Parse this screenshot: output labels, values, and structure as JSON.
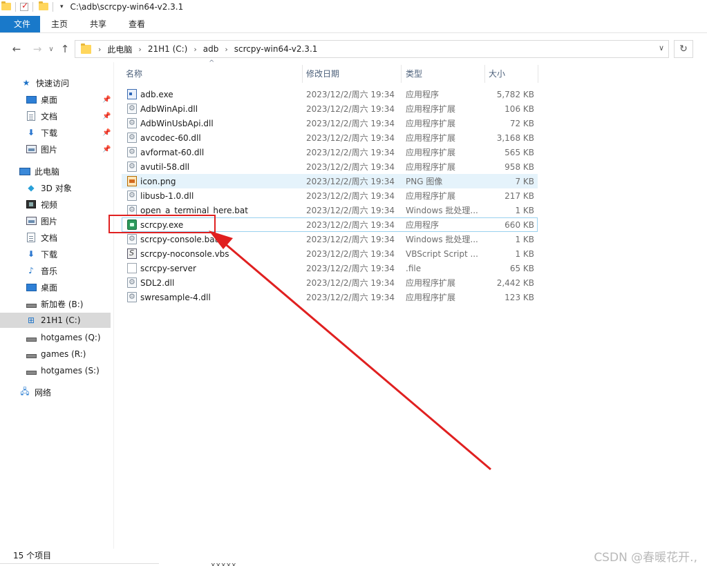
{
  "titlebar": {
    "title": "C:\\adb\\scrcpy-win64-v2.3.1",
    "dropdown": "▾"
  },
  "ribbon": {
    "tabs": [
      "文件",
      "主页",
      "共享",
      "查看"
    ]
  },
  "nav": {
    "back": "←",
    "forward": "→",
    "recent": "∨",
    "up": "↑",
    "breadcrumb": [
      "此电脑",
      "21H1 (C:)",
      "adb",
      "scrcpy-win64-v2.3.1"
    ],
    "crumb_sep": "›",
    "addr_dropdown": "∨",
    "refresh": "↻"
  },
  "sidebar": {
    "quick_access": "快速访问",
    "quick_items": [
      "桌面",
      "文档",
      "下载",
      "图片"
    ],
    "this_pc": "此电脑",
    "pc_items": [
      "3D 对象",
      "视频",
      "图片",
      "文档",
      "下载",
      "音乐",
      "桌面"
    ],
    "drives": [
      "新加卷 (B:)",
      "21H1 (C:)",
      "hotgames (Q:)",
      "games (R:)",
      "hotgames (S:)"
    ],
    "network": "网络",
    "pin": "📌"
  },
  "columns": {
    "name": "名称",
    "modified": "修改日期",
    "type": "类型",
    "size": "大小",
    "sort_indicator": "^"
  },
  "files": [
    {
      "name": "adb.exe",
      "date": "2023/12/2/周六 19:34",
      "type": "应用程序",
      "size": "5,782 KB"
    },
    {
      "name": "AdbWinApi.dll",
      "date": "2023/12/2/周六 19:34",
      "type": "应用程序扩展",
      "size": "106 KB"
    },
    {
      "name": "AdbWinUsbApi.dll",
      "date": "2023/12/2/周六 19:34",
      "type": "应用程序扩展",
      "size": "72 KB"
    },
    {
      "name": "avcodec-60.dll",
      "date": "2023/12/2/周六 19:34",
      "type": "应用程序扩展",
      "size": "3,168 KB"
    },
    {
      "name": "avformat-60.dll",
      "date": "2023/12/2/周六 19:34",
      "type": "应用程序扩展",
      "size": "565 KB"
    },
    {
      "name": "avutil-58.dll",
      "date": "2023/12/2/周六 19:34",
      "type": "应用程序扩展",
      "size": "958 KB"
    },
    {
      "name": "icon.png",
      "date": "2023/12/2/周六 19:34",
      "type": "PNG 图像",
      "size": "7 KB"
    },
    {
      "name": "libusb-1.0.dll",
      "date": "2023/12/2/周六 19:34",
      "type": "应用程序扩展",
      "size": "217 KB"
    },
    {
      "name": "open_a_terminal_here.bat",
      "date": "2023/12/2/周六 19:34",
      "type": "Windows 批处理...",
      "size": "1 KB"
    },
    {
      "name": "scrcpy.exe",
      "date": "2023/12/2/周六 19:34",
      "type": "应用程序",
      "size": "660 KB"
    },
    {
      "name": "scrcpy-console.bat",
      "date": "2023/12/2/周六 19:34",
      "type": "Windows 批处理...",
      "size": "1 KB"
    },
    {
      "name": "scrcpy-noconsole.vbs",
      "date": "2023/12/2/周六 19:34",
      "type": "VBScript Script ...",
      "size": "1 KB"
    },
    {
      "name": "scrcpy-server",
      "date": "2023/12/2/周六 19:34",
      "type": ".file",
      "size": "65 KB"
    },
    {
      "name": "SDL2.dll",
      "date": "2023/12/2/周六 19:34",
      "type": "应用程序扩展",
      "size": "2,442 KB"
    },
    {
      "name": "swresample-4.dll",
      "date": "2023/12/2/周六 19:34",
      "type": "应用程序扩展",
      "size": "123 KB"
    }
  ],
  "status": {
    "count": "15 个项目"
  },
  "watermark": "CSDN @春暖花开.,",
  "bottom_fragment": "..xxxxx..",
  "colors": {
    "ribbon_file": "#1979ca",
    "annotation": "#e02020",
    "hover_row": "#e5f3fb",
    "selected_border": "#99d1ef"
  }
}
